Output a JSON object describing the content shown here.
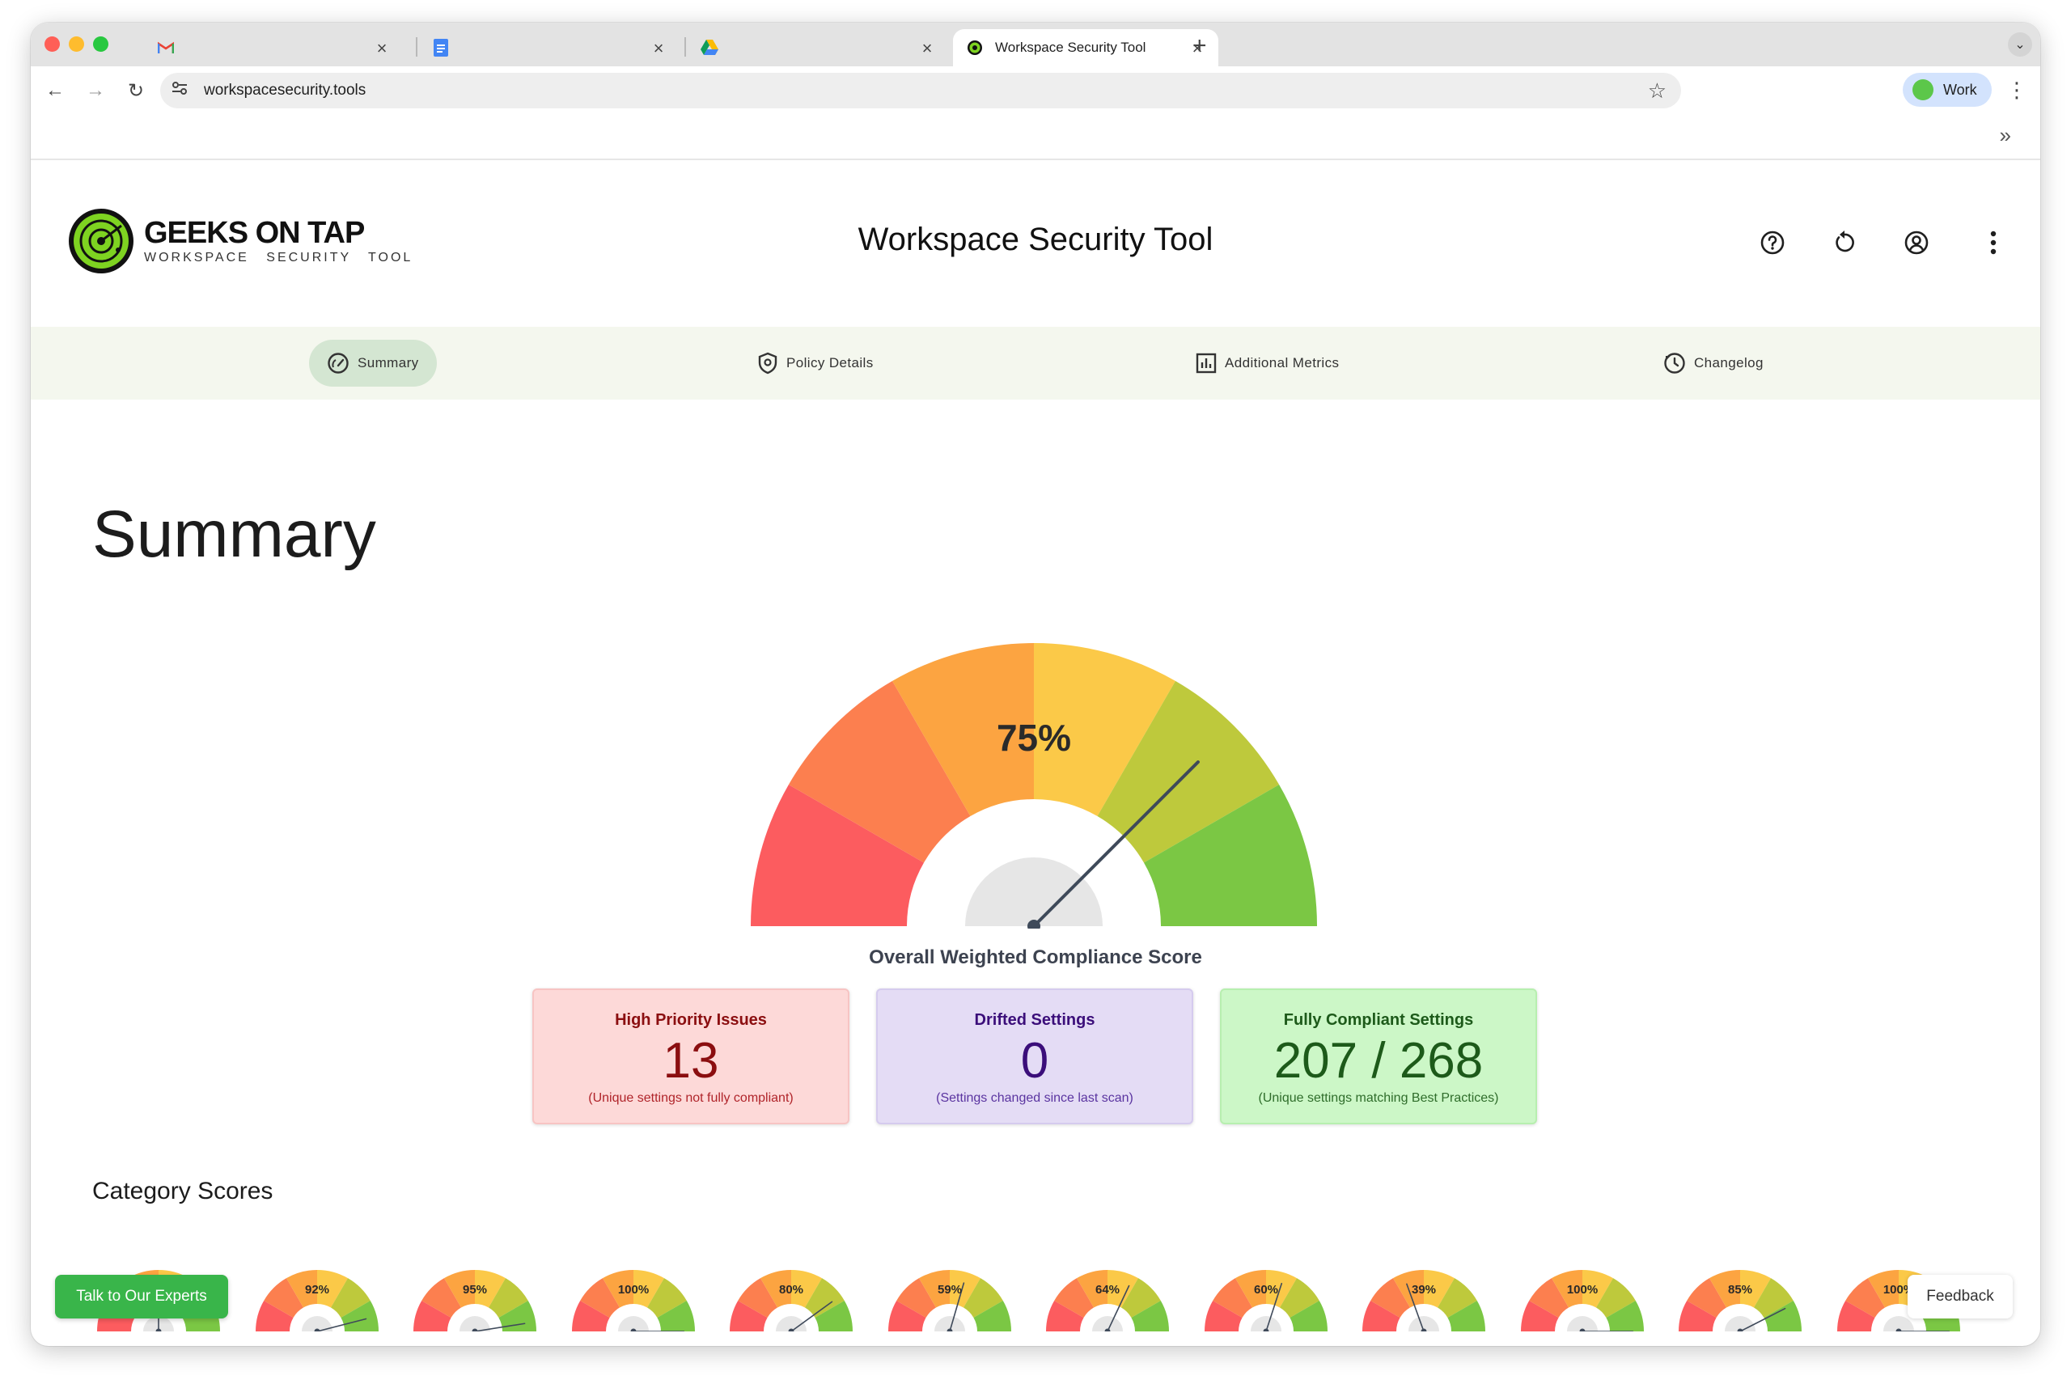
{
  "browser": {
    "tabs": [
      {
        "title": "",
        "icon": "gmail-icon"
      },
      {
        "title": "",
        "icon": "docs-icon"
      },
      {
        "title": "",
        "icon": "drive-icon"
      },
      {
        "title": "Workspace Security Tool",
        "icon": "app-favicon",
        "active": true
      }
    ],
    "url": "workspacesecurity.tools",
    "profile_label": "Work"
  },
  "header": {
    "logo_name": "GEEKS ON TAP",
    "logo_sub": "WORKSPACE SECURITY TOOL",
    "title": "Workspace Security Tool"
  },
  "nav": {
    "items": [
      {
        "label": "Summary",
        "icon": "speedometer-icon",
        "selected": true
      },
      {
        "label": "Policy Details",
        "icon": "shield-icon"
      },
      {
        "label": "Additional Metrics",
        "icon": "bar-chart-icon"
      },
      {
        "label": "Changelog",
        "icon": "history-icon"
      }
    ]
  },
  "main": {
    "title": "Summary",
    "overall": {
      "percent_label": "75%",
      "value": 0.75,
      "label": "Overall Weighted Compliance Score"
    },
    "cards": {
      "high_priority": {
        "title": "High Priority Issues",
        "value": "13",
        "sub": "(Unique settings not fully compliant)"
      },
      "drifted": {
        "title": "Drifted Settings",
        "value": "0",
        "sub": "(Settings changed since last scan)"
      },
      "compliant": {
        "title": "Fully Compliant Settings",
        "value": "207 / 268",
        "sub": "(Unique settings matching Best Practices)"
      }
    },
    "category_title": "Category Scores",
    "category_scores": [
      {
        "label": "",
        "value": 0.5
      },
      {
        "label": "92%",
        "value": 0.92
      },
      {
        "label": "95%",
        "value": 0.95
      },
      {
        "label": "100%",
        "value": 1.0
      },
      {
        "label": "80%",
        "value": 0.8
      },
      {
        "label": "59%",
        "value": 0.59
      },
      {
        "label": "64%",
        "value": 0.64
      },
      {
        "label": "60%",
        "value": 0.6
      },
      {
        "label": "39%",
        "value": 0.39
      },
      {
        "label": "100%",
        "value": 1.0
      },
      {
        "label": "85%",
        "value": 0.85
      },
      {
        "label": "100%",
        "value": 1.0
      }
    ]
  },
  "actions": {
    "talk": "Talk to Our Experts",
    "feedback": "Feedback"
  },
  "colors": {
    "gauge_segments": [
      "#fc5c5f",
      "#fc7f4f",
      "#fca441",
      "#fbc948",
      "#bec93c",
      "#7bc744"
    ],
    "brand_green": "#39b54a",
    "needle": "#3f4a5a"
  }
}
